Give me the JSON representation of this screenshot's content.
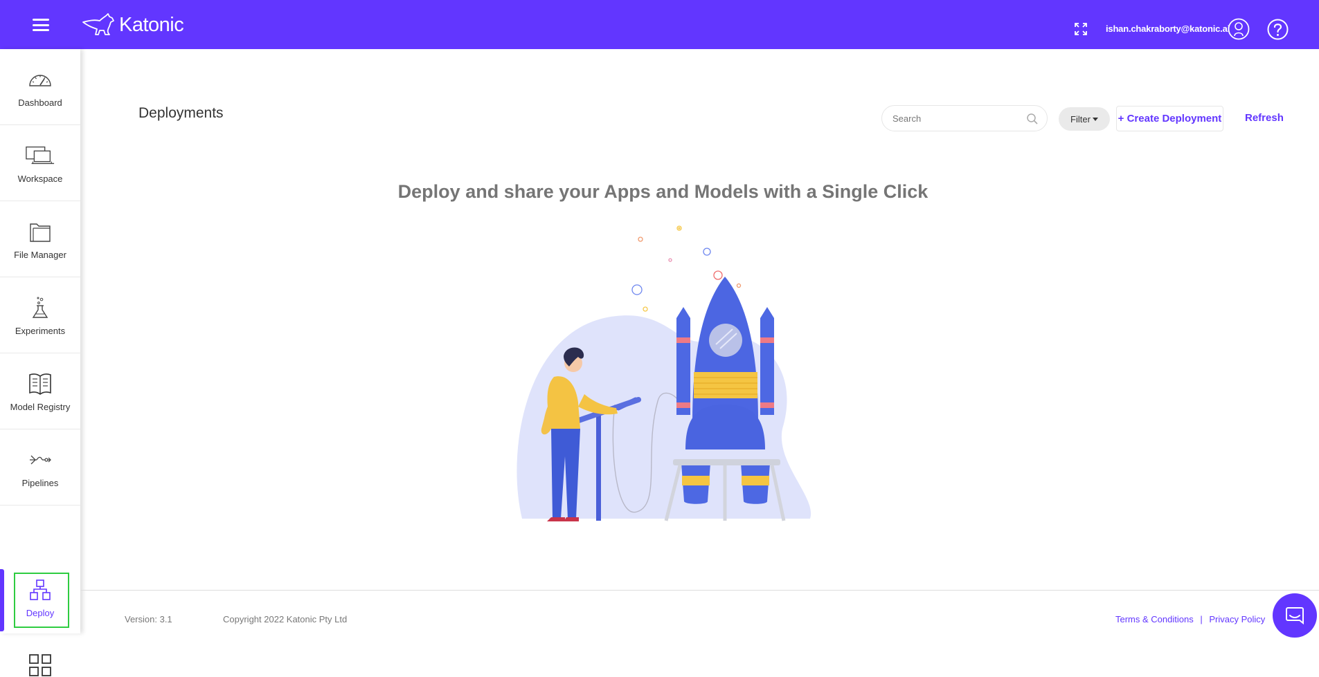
{
  "header": {
    "brand": "Katonic",
    "user_email": "ishan.chakraborty@katonic.ai",
    "icons": [
      "menu-icon",
      "kangaroo-logo-icon",
      "fullscreen-icon",
      "user-icon",
      "help-icon"
    ]
  },
  "sidebar": {
    "items": [
      {
        "label": "Dashboard",
        "icon": "gauge-icon"
      },
      {
        "label": "Workspace",
        "icon": "devices-icon"
      },
      {
        "label": "File Manager",
        "icon": "folder-icon"
      },
      {
        "label": "Experiments",
        "icon": "flask-icon"
      },
      {
        "label": "Model Registry",
        "icon": "book-icon"
      },
      {
        "label": "Pipelines",
        "icon": "pipeline-icon"
      },
      {
        "label": "Deploy",
        "icon": "network-icon",
        "active": true
      },
      {
        "label": "",
        "icon": "grid-icon"
      }
    ]
  },
  "main": {
    "title": "Deployments",
    "search_placeholder": "Search",
    "filter_label": "Filter",
    "create_label": "+ Create Deployment",
    "refresh_label": "Refresh",
    "headline": "Deploy and share your Apps and Models with a Single Click"
  },
  "footer": {
    "version": "Version: 3.1",
    "copyright": "Copyright 2022 Katonic Pty Ltd",
    "terms": "Terms & Conditions",
    "separator": "|",
    "privacy": "Privacy Policy"
  },
  "colors": {
    "brand": "#6236ff",
    "active_outline": "#2ecc40",
    "headline": "#757575"
  }
}
